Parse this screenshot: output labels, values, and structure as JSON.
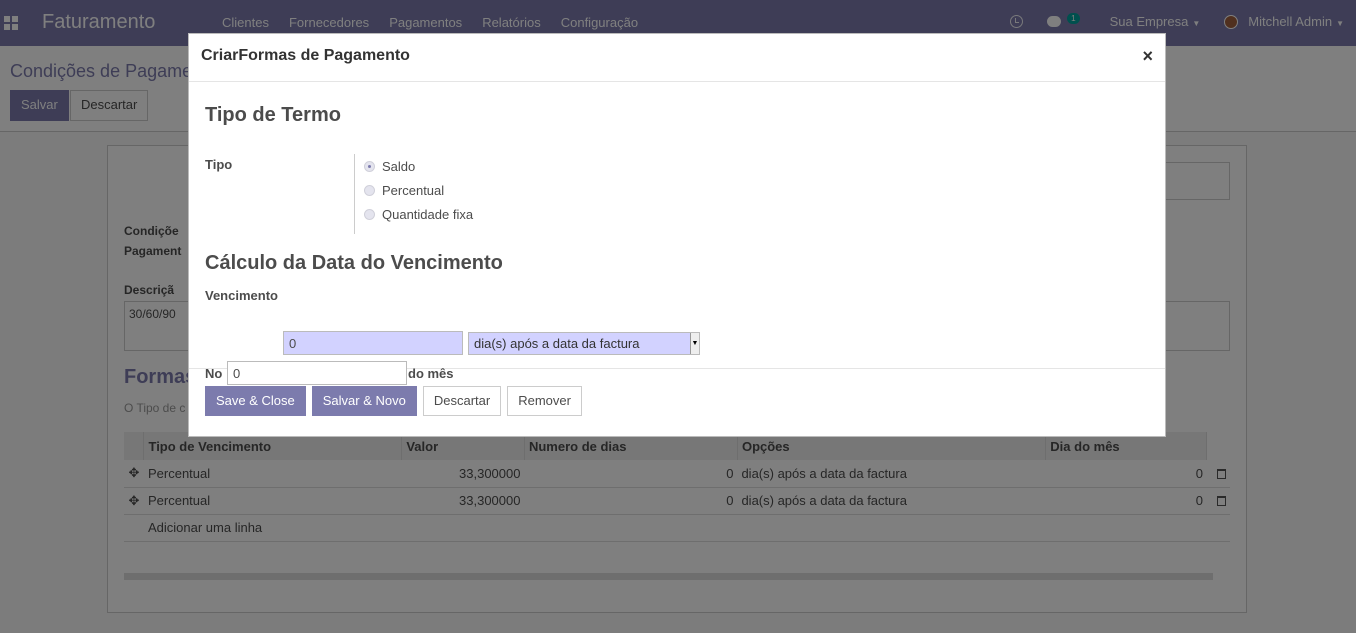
{
  "navbar": {
    "app_title": "Faturamento",
    "menu": [
      "Clientes",
      "Fornecedores",
      "Pagamentos",
      "Relatórios",
      "Configuração"
    ],
    "message_count": "1",
    "company": "Sua Empresa",
    "user": "Mitchell Admin"
  },
  "background": {
    "breadcrumb": "Condições de Pagame",
    "save_label": "Salvar",
    "discard_label": "Descartar",
    "cond_label_1": "Condiçõe",
    "cond_label_2": "Pagament",
    "desc_label": "Descriçã",
    "desc_value": "30/60/90",
    "section_title": "Formas",
    "section_hint": "O Tipo de c",
    "table": {
      "headers": [
        "Tipo de Vencimento",
        "Valor",
        "Numero de dias",
        "Opções",
        "Dia do mês"
      ],
      "rows": [
        [
          "Percentual",
          "33,300000",
          "0",
          "dia(s) após a data da factura",
          "0"
        ],
        [
          "Percentual",
          "33,300000",
          "0",
          "dia(s) após a data da factura",
          "0"
        ]
      ],
      "add_line": "Adicionar uma linha"
    }
  },
  "modal": {
    "title": "CriarFormas de Pagamento",
    "close": "×",
    "section1_title": "Tipo de Termo",
    "tipo_label": "Tipo",
    "tipo_options": [
      "Saldo",
      "Percentual",
      "Quantidade fixa"
    ],
    "tipo_selected": "Saldo",
    "section2_title": "Cálculo da Data do Vencimento",
    "vencimento_label": "Vencimento",
    "vencimento_value": "0",
    "option_value": "dia(s) após a data da factura",
    "no_label": "No",
    "no_value": "0",
    "do_mes_label": "do mês",
    "buttons": {
      "save_close": "Save & Close",
      "save_new": "Salvar & Novo",
      "discard": "Descartar",
      "remove": "Remover"
    }
  },
  "colors": {
    "brand": "#7c7bad",
    "required_field": "#d2d2ff",
    "badge": "#00a09d"
  }
}
